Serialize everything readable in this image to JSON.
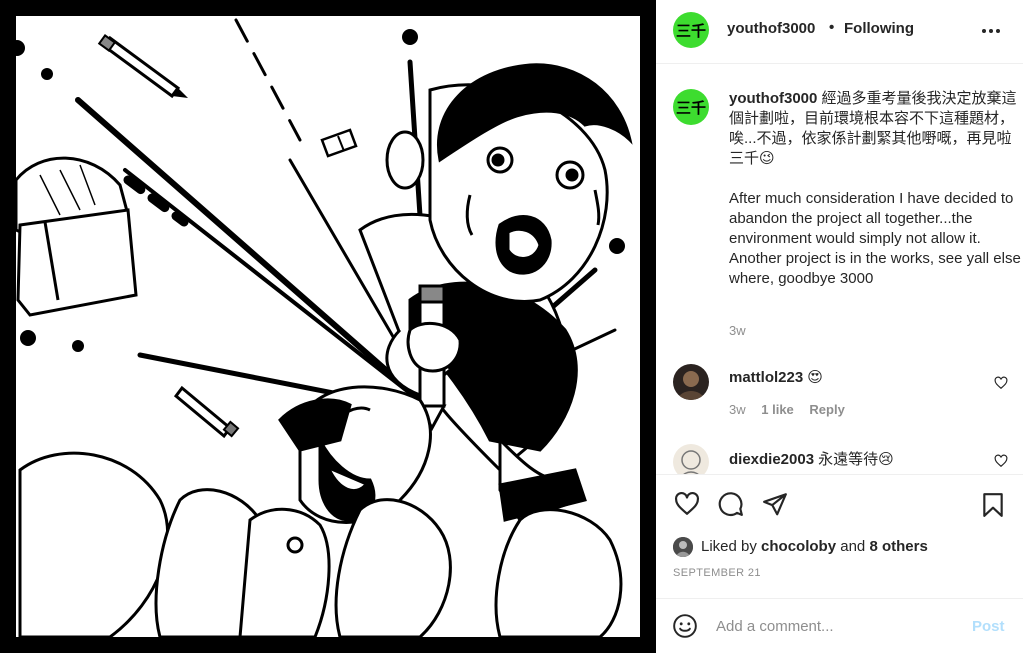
{
  "post": {
    "author": "youthof3000",
    "separator": "•",
    "follow_label": "Following",
    "logo_text": "三千"
  },
  "caption": {
    "username": "youthof3000",
    "text_zh": "經過多重考量後我決定放棄這個計劃啦，目前環境根本容不下這種題材，唉...不過，依家係計劃緊其他嘢嘅，再見啦三千😉",
    "text_en": "After much consideration I have decided to abandon the project all together...the environment would simply not allow it. Another project is in the works, see yall else where, goodbye 3000",
    "age": "3w"
  },
  "comments": [
    {
      "username": "mattlol223",
      "text": "😍",
      "age": "3w",
      "likes": "1 like",
      "reply": "Reply"
    },
    {
      "username": "diexdie2003",
      "text": "永遠等待😢"
    }
  ],
  "likes": {
    "prefix": "Liked by",
    "user": "chocoloby",
    "and": "and",
    "others": "8 others"
  },
  "date": "SEPTEMBER 21",
  "add_comment": {
    "placeholder": "Add a comment...",
    "post_label": "Post"
  },
  "colors": {
    "logo_green": "#3ddc2f",
    "link_blue_disabled": "#b2dffc",
    "muted": "#8e8e8e"
  },
  "icons": [
    "more-icon",
    "heart-icon",
    "comment-icon",
    "share-icon",
    "bookmark-icon",
    "emoji-icon"
  ]
}
